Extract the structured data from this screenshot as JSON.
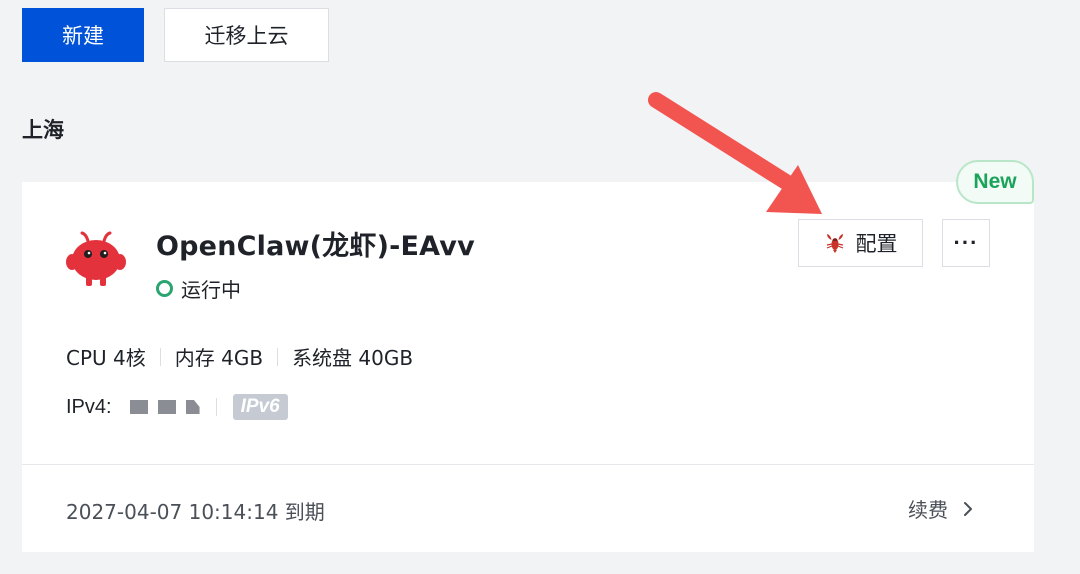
{
  "toolbar": {
    "create_label": "新建",
    "migrate_label": "迁移上云"
  },
  "region": {
    "title": "上海"
  },
  "card": {
    "badge": "New",
    "name": "OpenClaw(龙虾)-EAvv",
    "status": "运行中",
    "config_label": "配置",
    "more_label": "···",
    "specs": [
      "CPU 4核",
      "内存 4GB",
      "系统盘 40GB"
    ],
    "ipv4_label": "IPv4:",
    "ipv6_tag": "IPv6",
    "expiry": "2027-04-07 10:14:14 到期",
    "renew_label": "续费"
  },
  "colors": {
    "primary": "#0052d9",
    "status_green": "#2ba471",
    "badge_green": "#1aa35a",
    "annotation_arrow": "#f25450",
    "mascot_red": "#e3323c"
  },
  "icons": {
    "config": "lobster-icon",
    "more": "more-icon",
    "renew": "chevron-right-icon"
  }
}
